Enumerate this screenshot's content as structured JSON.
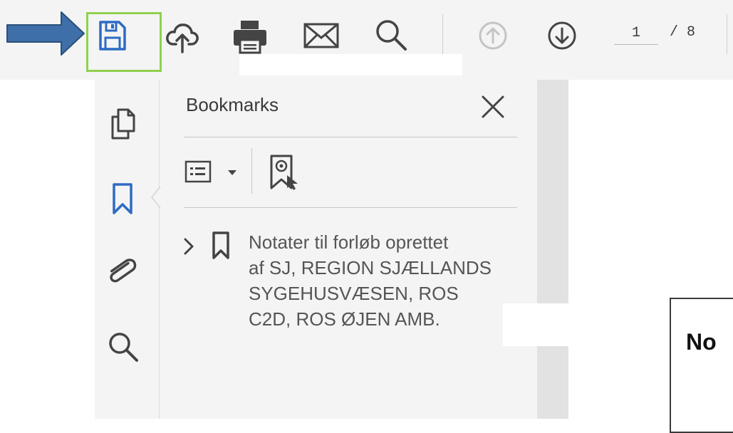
{
  "toolbar": {
    "tools": [
      {
        "name": "save",
        "icon": "save-icon"
      },
      {
        "name": "upload",
        "icon": "cloud-upload-icon"
      },
      {
        "name": "print",
        "icon": "printer-icon"
      },
      {
        "name": "email",
        "icon": "mail-icon"
      },
      {
        "name": "search",
        "icon": "search-icon"
      },
      {
        "name": "previous-page",
        "icon": "arrow-up-circle-icon"
      },
      {
        "name": "next-page",
        "icon": "arrow-down-circle-icon"
      }
    ],
    "page_current": "1",
    "page_total": "/ 8"
  },
  "annotation": {
    "arrow_color": "#3f6fa8",
    "highlight_color": "#8fd14f"
  },
  "left_rail": {
    "items": [
      {
        "name": "pages",
        "icon": "page-thumbnails-icon"
      },
      {
        "name": "bookmarks",
        "icon": "bookmark-icon",
        "active": true
      },
      {
        "name": "attachments",
        "icon": "paperclip-icon"
      },
      {
        "name": "search",
        "icon": "search-icon"
      }
    ]
  },
  "bookmarks_panel": {
    "title": "Bookmarks",
    "options_icon": "list-options-icon",
    "add_bookmark_icon": "new-bookmark-icon",
    "entry": {
      "lines": [
        "Notater til forløb oprettet",
        "af SJ, REGION SJÆLLANDS",
        "SYGEHUSVÆSEN, ROS",
        "C2D, ROS ØJEN AMB."
      ]
    }
  },
  "document": {
    "visible_text": "No"
  },
  "colors": {
    "accent": "#2d6bc4",
    "toolbar_bg": "#f4f4f4"
  }
}
